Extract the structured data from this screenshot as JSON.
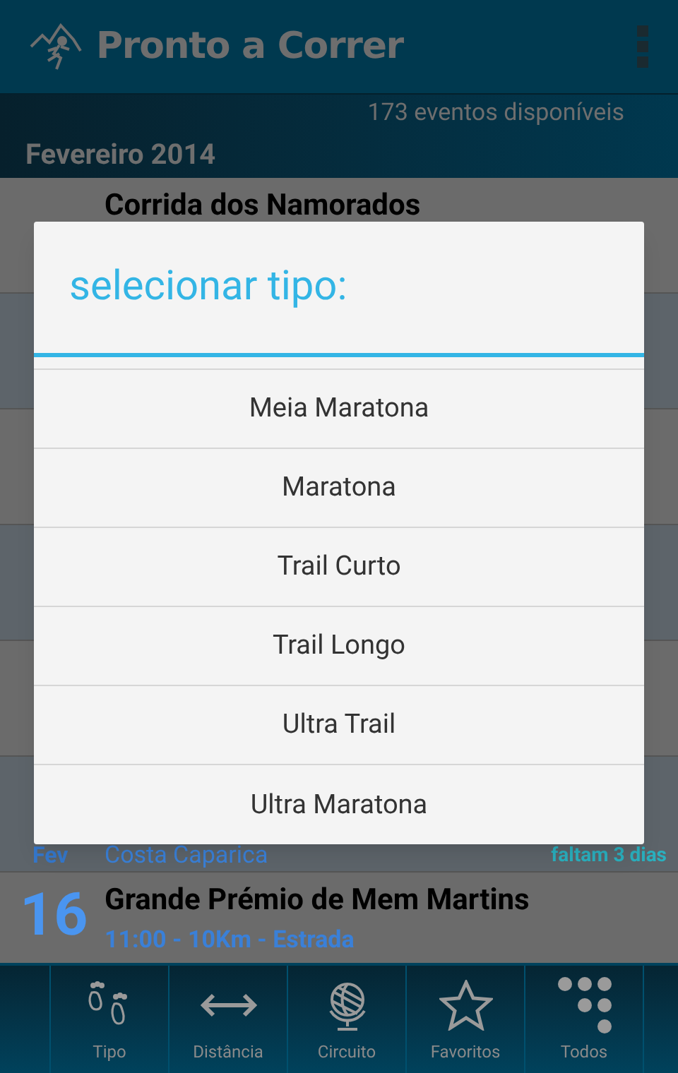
{
  "app_bar": {
    "title": "Pronto a Correr"
  },
  "summary": {
    "count_text": "173 eventos disponíveis",
    "month": "Fevereiro 2014"
  },
  "events": [
    {
      "kind": "event",
      "title": "Corrida dos Namorados"
    },
    {
      "kind": "event"
    },
    {
      "kind": "event"
    },
    {
      "kind": "event"
    },
    {
      "kind": "event"
    },
    {
      "kind": "event",
      "month": "Fev",
      "location": "Costa Caparica",
      "countdown": "faltam 3 dias"
    },
    {
      "kind": "event",
      "day": "16",
      "title": "Grande Prémio de Mem Martins",
      "details": "11:00 - 10Km - Estrada"
    }
  ],
  "dialog": {
    "title": "selecionar tipo:",
    "options": [
      "Meia Maratona",
      "Maratona",
      "Trail Curto",
      "Trail Longo",
      "Ultra Trail",
      "Ultra Maratona"
    ]
  },
  "bottom_nav": [
    {
      "kind": "feet",
      "label": "Tipo"
    },
    {
      "kind": "arrows",
      "label": "Distância"
    },
    {
      "kind": "globe",
      "label": "Circuito"
    },
    {
      "kind": "star",
      "label": "Favoritos"
    },
    {
      "kind": "dots",
      "label": "Todos"
    }
  ]
}
